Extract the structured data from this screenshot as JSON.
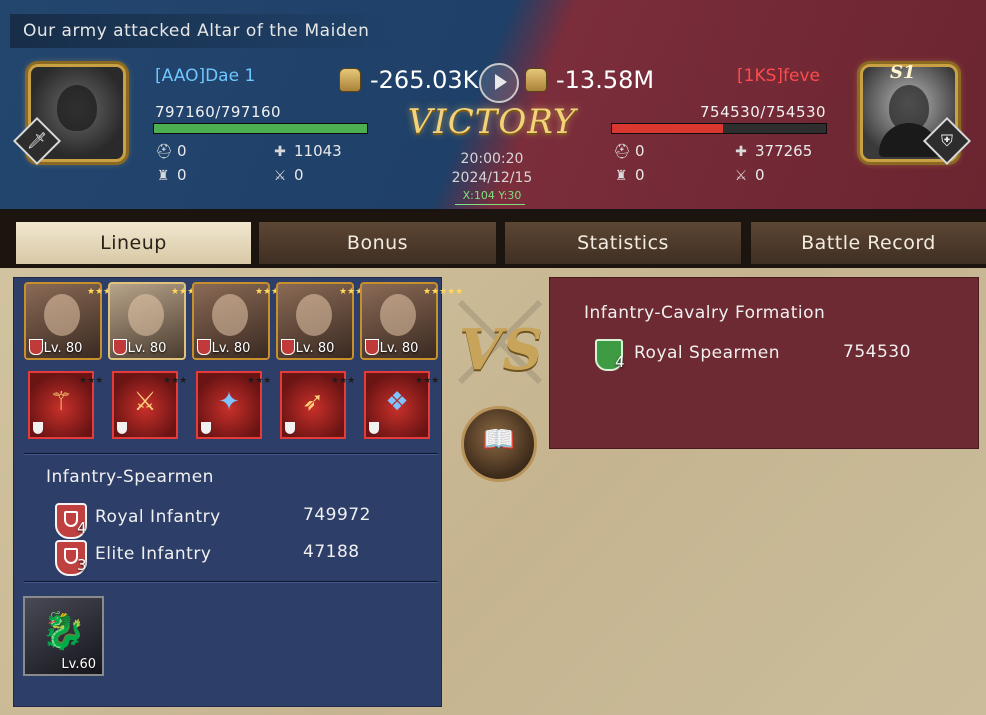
{
  "header": {
    "title": "Our army attacked Altar of the Maiden",
    "result": "VICTORY",
    "time": "20:00:20",
    "date": "2024/12/15",
    "coords": "X:104 Y:30"
  },
  "attacker": {
    "name": "[AAO]Dae 1",
    "hp_text": "797160/797160",
    "hp_fraction": 1.0,
    "bar_color": "#4caf50",
    "power_change": "-265.03K",
    "stats": {
      "dead": "0",
      "wounded": "11043",
      "tower": "0",
      "killed": "0"
    },
    "avatar": "boar-avatar"
  },
  "defender": {
    "name": "[1KS]feve",
    "hp_text": "754530/754530",
    "hp_fraction": 0.52,
    "bar_color": "#d9372f",
    "power_change": "-13.58M",
    "rank_tag": "S1",
    "stats": {
      "dead": "0",
      "wounded": "377265",
      "tower": "0",
      "killed": "0"
    },
    "avatar": "man-in-suit-avatar"
  },
  "tabs": [
    {
      "label": "Lineup",
      "active": true
    },
    {
      "label": "Bonus",
      "active": false
    },
    {
      "label": "Statistics",
      "active": false
    },
    {
      "label": "Battle Record",
      "active": false
    }
  ],
  "lineup": {
    "heroes": [
      {
        "level": "Lv. 80"
      },
      {
        "level": "Lv. 80"
      },
      {
        "level": "Lv. 80"
      },
      {
        "level": "Lv. 80"
      },
      {
        "level": "Lv. 80"
      }
    ],
    "equipment": [
      {
        "icon": "golden-spear-icon"
      },
      {
        "icon": "sword-icon"
      },
      {
        "icon": "blue-staff-icon"
      },
      {
        "icon": "bow-icon"
      },
      {
        "icon": "earrings-icon"
      }
    ],
    "formation": "Infantry-Spearmen",
    "troops": [
      {
        "name": "Royal Infantry",
        "tier": "4",
        "count": "749972"
      },
      {
        "name": "Elite Infantry",
        "tier": "3",
        "count": "47188"
      }
    ],
    "pet": {
      "level": "Lv.60",
      "icon": "dragon-icon"
    }
  },
  "enemy_lineup": {
    "formation": "Infantry-Cavalry Formation",
    "troops": [
      {
        "name": "Royal Spearmen",
        "tier": "4",
        "count": "754530"
      }
    ]
  },
  "center": {
    "vs": "VS",
    "book_icon": "battle-book-icon"
  },
  "colors": {
    "attacker_name": "#6fc7ff",
    "defender_name": "#ff4b4b",
    "victory": "#f3d27a"
  }
}
